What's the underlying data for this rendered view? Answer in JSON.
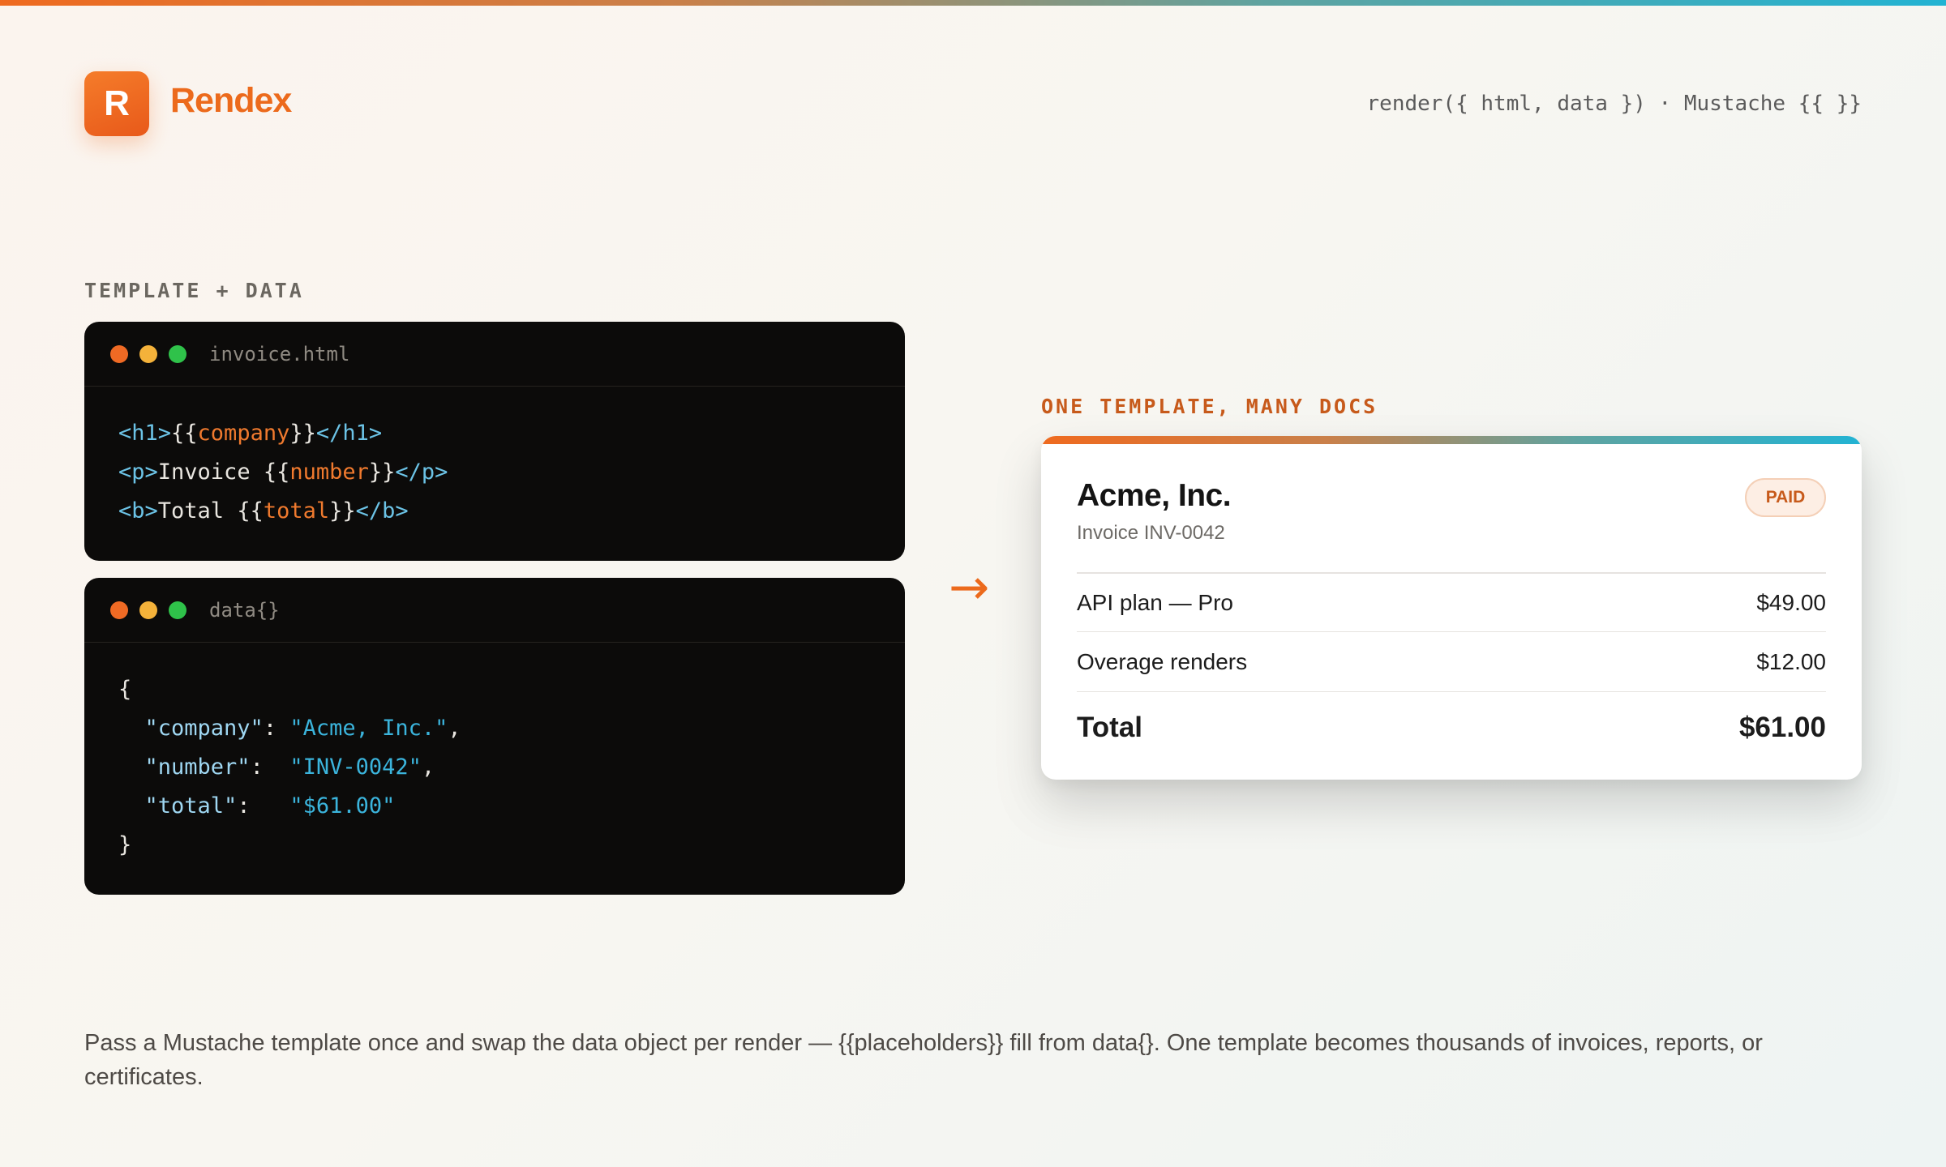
{
  "brand": {
    "logo_letter": "R",
    "name": "Rendex"
  },
  "header": {
    "signature": "render({ html, data }) · Mustache {{ }}"
  },
  "labels": {
    "left": "TEMPLATE + DATA",
    "right": "ONE TEMPLATE, MANY DOCS"
  },
  "template_panel": {
    "filename": "invoice.html",
    "lines": [
      [
        "<h1>",
        "{{",
        "company",
        "}}",
        "</h1>"
      ],
      [
        "<p>",
        "Invoice {{",
        "number",
        "}}",
        "</p>"
      ],
      [
        "<b>",
        "Total {{",
        "total",
        "}}",
        "</b>"
      ]
    ]
  },
  "data_panel": {
    "filename": "data{}",
    "open": "{",
    "close": "}",
    "entries": [
      {
        "key": "\"company\"",
        "sep": ": ",
        "value": "\"Acme, Inc.\"",
        "trail": ","
      },
      {
        "key": "\"number\"",
        "sep": ":  ",
        "value": "\"INV-0042\"",
        "trail": ","
      },
      {
        "key": "\"total\"",
        "sep": ":   ",
        "value": "\"$61.00\"",
        "trail": ""
      }
    ]
  },
  "arrow": "→",
  "invoice": {
    "company": "Acme, Inc.",
    "invoice_number": "Invoice INV-0042",
    "status": "PAID",
    "items": [
      {
        "label": "API plan — Pro",
        "amount": "$49.00"
      },
      {
        "label": "Overage renders",
        "amount": "$12.00"
      }
    ],
    "total_label": "Total",
    "total_amount": "$61.00"
  },
  "description": "Pass a Mustache template once and swap the data object per render — {{placeholders}} fill from data{}. One template becomes thousands of invoices, reports, or certificates.",
  "colors": {
    "accent": "#ec6a1c",
    "teal": "#22b3d3",
    "panel_bg": "#0c0b0a"
  }
}
